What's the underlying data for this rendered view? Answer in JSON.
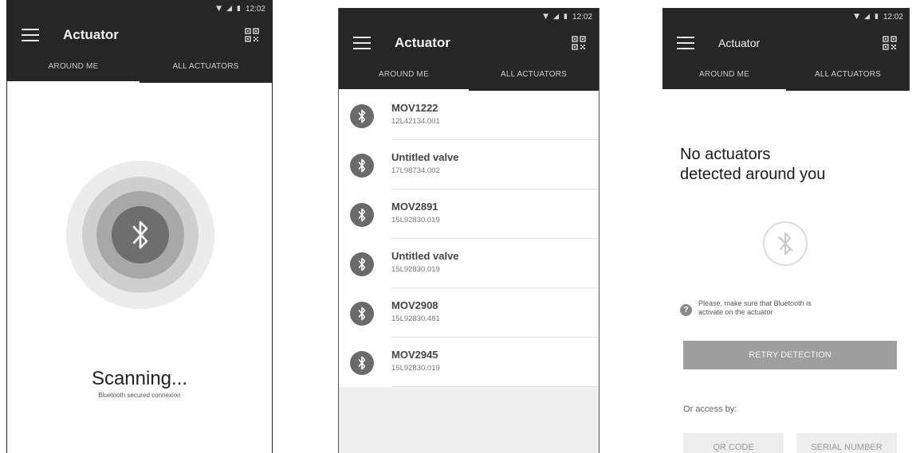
{
  "status_bar": {
    "time": "12:02"
  },
  "app": {
    "title": "Actuator"
  },
  "tabs": {
    "around_me": "AROUND ME",
    "all_actuators": "ALL ACTUATORS"
  },
  "scanning": {
    "title": "Scanning...",
    "subtitle": "Bluetooth secured connexion"
  },
  "actuators": [
    {
      "name": "MOV1222",
      "serial": "12L42134.001"
    },
    {
      "name": "Untitled valve",
      "serial": "17L98734.002"
    },
    {
      "name": "MOV2891",
      "serial": "15L92830.019"
    },
    {
      "name": "Untitled valve",
      "serial": "15L92830.019"
    },
    {
      "name": "MOV2908",
      "serial": "15L92830.481"
    },
    {
      "name": "MOV2945",
      "serial": "15L92830.019"
    }
  ],
  "empty_state": {
    "title_line1": "No actuators",
    "title_line2": "detected around you",
    "help_line1": "Please, make sure that Bluetooth is",
    "help_line2": "activate on the actuator",
    "help_icon": "?",
    "retry_label": "RETRY DETECTION",
    "access_label": "Or access by:",
    "qr_code_label": "QR CODE",
    "serial_number_label": "SERIAL NUMBER"
  },
  "icons": {
    "status": [
      "wifi-icon",
      "signal-icon",
      "battery-icon"
    ],
    "menu": "menu-icon",
    "qr": "qr-code-icon",
    "bluetooth": "bluetooth-icon",
    "bluetooth_off": "bluetooth-disabled-icon"
  },
  "colors": {
    "app_bar": "#262626",
    "ring_light": "#ececec",
    "ring_mid": "#cfcfcf",
    "ring_dark": "#a8a8a8",
    "bt_circle": "#6e6e6e",
    "retry_button": "#9e9e9e"
  }
}
